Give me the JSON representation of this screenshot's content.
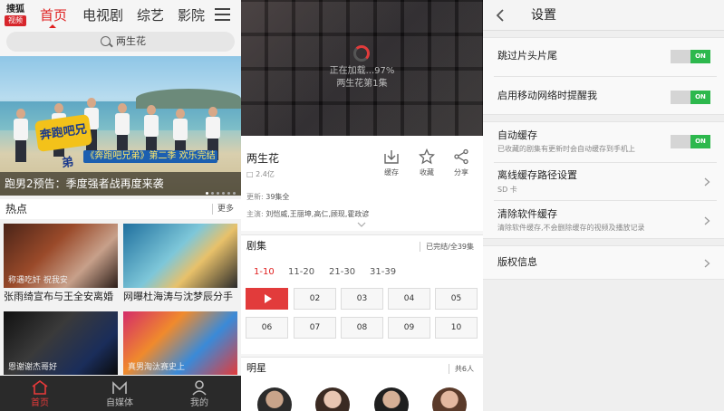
{
  "home": {
    "logo_top": "搜狐",
    "logo_bottom": "视频",
    "tabs": [
      "首页",
      "电视剧",
      "综艺",
      "影院"
    ],
    "active_tab": 0,
    "search_text": "两生花",
    "hero": {
      "caption": "跑男2预告：季度强者战再度来袭",
      "show_logo": "奔跑吧兄弟",
      "badge": "《奔跑吧兄弟》第二季 欢乐完结",
      "dots": 6,
      "active_dot": 0
    },
    "hot": {
      "title": "热点",
      "more": "更多",
      "items": [
        {
          "overlay": "称遇吃奸 祝我安",
          "caption": "张雨绮宣布与王全安离婚"
        },
        {
          "overlay": "",
          "caption": "网曝杜海涛与沈梦辰分手"
        },
        {
          "overlay": "恩谢谢杰哥好",
          "caption": ""
        },
        {
          "overlay": "真男淘汰赛史上",
          "caption": ""
        }
      ]
    },
    "bottom_nav": [
      {
        "label": "首页",
        "icon": "home-icon"
      },
      {
        "label": "自媒体",
        "icon": "media-icon"
      },
      {
        "label": "我的",
        "icon": "user-icon"
      }
    ],
    "active_nav": 0,
    "accent": "#e02020"
  },
  "detail": {
    "loading_text": "正在加载...97%",
    "episode_line": "两生花第1集",
    "title": "两生花",
    "views": "2.4亿",
    "actions": [
      {
        "label": "缓存",
        "icon": "download-icon"
      },
      {
        "label": "收藏",
        "icon": "star-icon"
      },
      {
        "label": "分享",
        "icon": "share-icon"
      }
    ],
    "update_label": "更新:",
    "update_value": "39集全",
    "cast_label": "主演:",
    "cast_value": "刘恺威,王丽坤,高仁,顾现,霍政谚",
    "episodes_title": "剧集",
    "episodes_status": "已完结/全39集",
    "ranges": [
      "1-10",
      "11-20",
      "21-30",
      "31-39"
    ],
    "active_range": 0,
    "episodes": [
      "01",
      "02",
      "03",
      "04",
      "05",
      "06",
      "07",
      "08",
      "09",
      "10"
    ],
    "playing_index": 0,
    "stars_title": "明星",
    "stars_count": "共6人",
    "accent": "#e23b3b"
  },
  "settings": {
    "title": "设置",
    "groups": [
      {
        "rows": [
          {
            "label": "跳过片头片尾",
            "sub": "",
            "control": "toggle",
            "state": "ON"
          },
          {
            "label": "启用移动网络时提醒我",
            "sub": "",
            "control": "toggle",
            "state": "ON"
          }
        ]
      },
      {
        "rows": [
          {
            "label": "自动缓存",
            "sub": "已收藏的剧集有更新时会自动缓存到手机上",
            "control": "toggle",
            "state": "ON"
          },
          {
            "label": "离线缓存路径设置",
            "sub": "SD 卡",
            "control": "chevron"
          },
          {
            "label": "清除软件缓存",
            "sub": "清除软件缓存,不会删除缓存的视频及播放记录",
            "control": "chevron"
          }
        ]
      },
      {
        "rows": [
          {
            "label": "版权信息",
            "sub": "",
            "control": "chevron"
          }
        ]
      }
    ],
    "toggle_on_color": "#2db84d"
  }
}
